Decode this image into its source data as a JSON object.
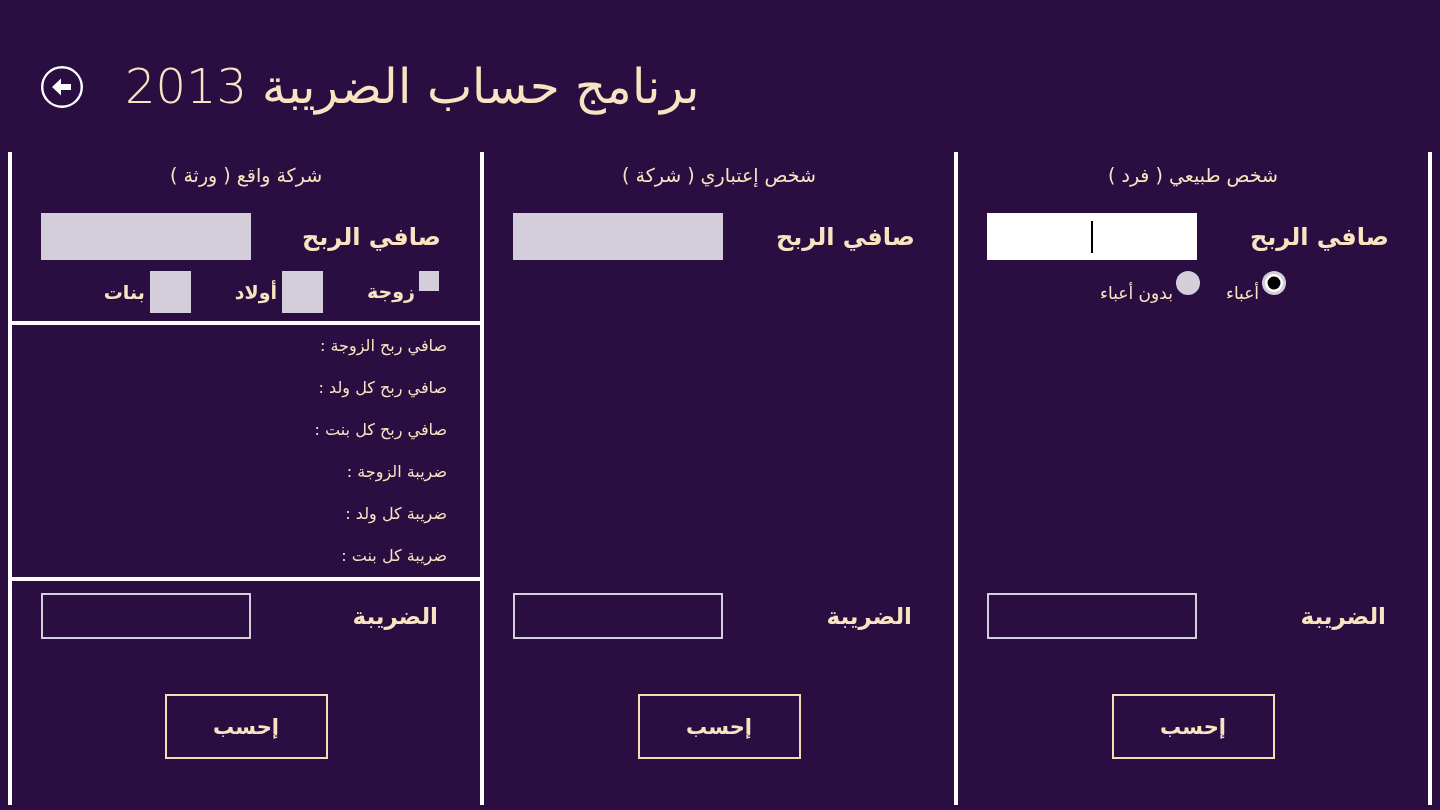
{
  "header": {
    "title": "برنامج حساب الضريبة 2013"
  },
  "panels": [
    {
      "title": "شخص طبيعي ( فرد )",
      "profit": {
        "label": "صافي الربح",
        "focused": true
      },
      "options": [
        {
          "kind": "radio",
          "label": "أعباء",
          "selected": true
        },
        {
          "kind": "radio",
          "label": "بدون أعباء",
          "selected": false
        }
      ],
      "tax": {
        "label": "الضريبة"
      },
      "button": "إحسب"
    },
    {
      "title": "شخص إعتباري ( شركة )",
      "profit": {
        "label": "صافي الربح",
        "focused": false
      },
      "tax": {
        "label": "الضريبة"
      },
      "button": "إحسب"
    },
    {
      "title": "شركة واقع ( ورثة )",
      "profit": {
        "label": "صافي الربح",
        "focused": false
      },
      "options": [
        {
          "kind": "checkbox",
          "label": "زوجة",
          "checked": false
        },
        {
          "kind": "count",
          "label": "أولاد"
        },
        {
          "kind": "count",
          "label": "بنات"
        }
      ],
      "details": [
        "صافي ربح الزوجة :",
        "صافي ربح كل ولد :",
        "صافي ربح كل بنت :",
        "ضريبة الزوجة :",
        "ضريبة كل ولد :",
        "ضريبة كل بنت :"
      ],
      "tax": {
        "label": "الضريبة"
      },
      "button": "إحسب"
    }
  ]
}
